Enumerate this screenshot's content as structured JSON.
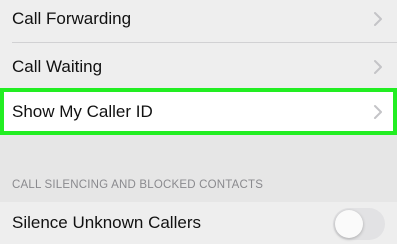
{
  "settings": {
    "call_forwarding": "Call Forwarding",
    "call_waiting": "Call Waiting",
    "show_caller_id": "Show My Caller ID",
    "section_header": "CALL SILENCING AND BLOCKED CONTACTS",
    "silence_unknown": "Silence Unknown Callers",
    "silence_unknown_enabled": false
  },
  "icons": {
    "chevron": "chevron-right-icon"
  },
  "colors": {
    "highlight_border": "#22ee22",
    "chevron": "#c4c4c7",
    "section_header": "#8a8a8e"
  }
}
